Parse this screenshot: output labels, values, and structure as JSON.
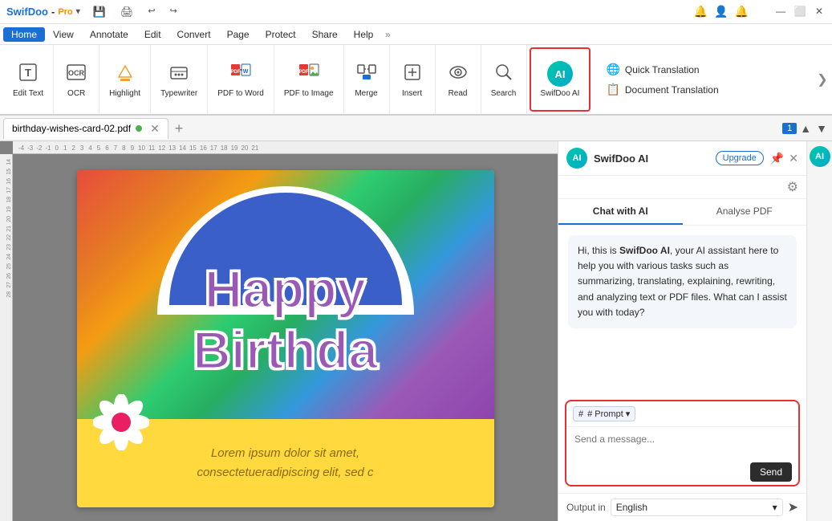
{
  "titlebar": {
    "app_name": "SwifDoo",
    "app_pro": "Pro",
    "dropdown_arrow": "▾",
    "controls": [
      "—",
      "⬜",
      "✕"
    ]
  },
  "menubar": {
    "items": [
      "Home",
      "View",
      "Annotate",
      "Edit",
      "Convert",
      "Page",
      "Protect",
      "Share",
      "Help"
    ],
    "active": "Home",
    "more": "»"
  },
  "ribbon": {
    "buttons": [
      {
        "id": "edit-text",
        "label": "Edit Text",
        "icon": "T"
      },
      {
        "id": "ocr",
        "label": "OCR",
        "icon": "📄"
      },
      {
        "id": "highlight",
        "label": "Highlight",
        "icon": "🖊"
      },
      {
        "id": "typewriter",
        "label": "Typewriter",
        "icon": "✏️"
      },
      {
        "id": "pdf-to-word",
        "label": "PDF to Word",
        "icon": "W"
      },
      {
        "id": "pdf-to-image",
        "label": "PDF to Image",
        "icon": "🖼"
      },
      {
        "id": "merge",
        "label": "Merge",
        "icon": "⊞"
      },
      {
        "id": "insert",
        "label": "Insert",
        "icon": "⊕"
      },
      {
        "id": "read",
        "label": "Read",
        "icon": "📖"
      },
      {
        "id": "search",
        "label": "Search",
        "icon": "🔍"
      },
      {
        "id": "swifdoo-ai",
        "label": "SwifDoo AI",
        "icon": "AI"
      }
    ],
    "flyout": {
      "items": [
        {
          "label": "Quick Translation",
          "icon": "🌐"
        },
        {
          "label": "Document Translation",
          "icon": "📋"
        }
      ]
    }
  },
  "doctab": {
    "filename": "birthday-wishes-card-02.pdf",
    "page_current": "1",
    "nav_up": "▲",
    "nav_down": "▼"
  },
  "ruler": {
    "h_ticks": [
      "-4",
      "-3",
      "-2",
      "-1",
      "0",
      "1",
      "2",
      "3",
      "4",
      "5",
      "6",
      "7",
      "8",
      "9",
      "10",
      "11",
      "12",
      "13",
      "14",
      "15",
      "16",
      "17",
      "18",
      "19",
      "20",
      "21"
    ]
  },
  "card": {
    "happy": "Happy",
    "birthday": "Birthda",
    "lorem": "Lorem ipsum dolor sit amet,",
    "lorem2": "consectetueradipiscing elit, sed c"
  },
  "ai_panel": {
    "avatar_text": "AI",
    "title": "SwifDoo AI",
    "upgrade_label": "Upgrade",
    "close_icon": "✕",
    "pin_icon": "📌",
    "settings_icon": "⚙",
    "tabs": [
      {
        "label": "Chat with AI",
        "active": true
      },
      {
        "label": "Analyse PDF",
        "active": false
      }
    ],
    "message": "Hi, this is SwifDoo AI, your AI assistant here to help you with various tasks such as summarizing, translating, explaining, rewriting, and analyzing text or PDF files. What can I assist you with today?",
    "message_bold": "SwifDoo AI",
    "prompt_label": "# Prompt",
    "prompt_arrow": "▾",
    "input_placeholder": "Send a message...",
    "send_label": "Send",
    "output_label": "Output in",
    "output_lang": "English",
    "output_arrow": "▾",
    "send_icon": "➤"
  },
  "right_sidebar": {
    "avatar_text": "AI",
    "settings_icon": "≡"
  }
}
